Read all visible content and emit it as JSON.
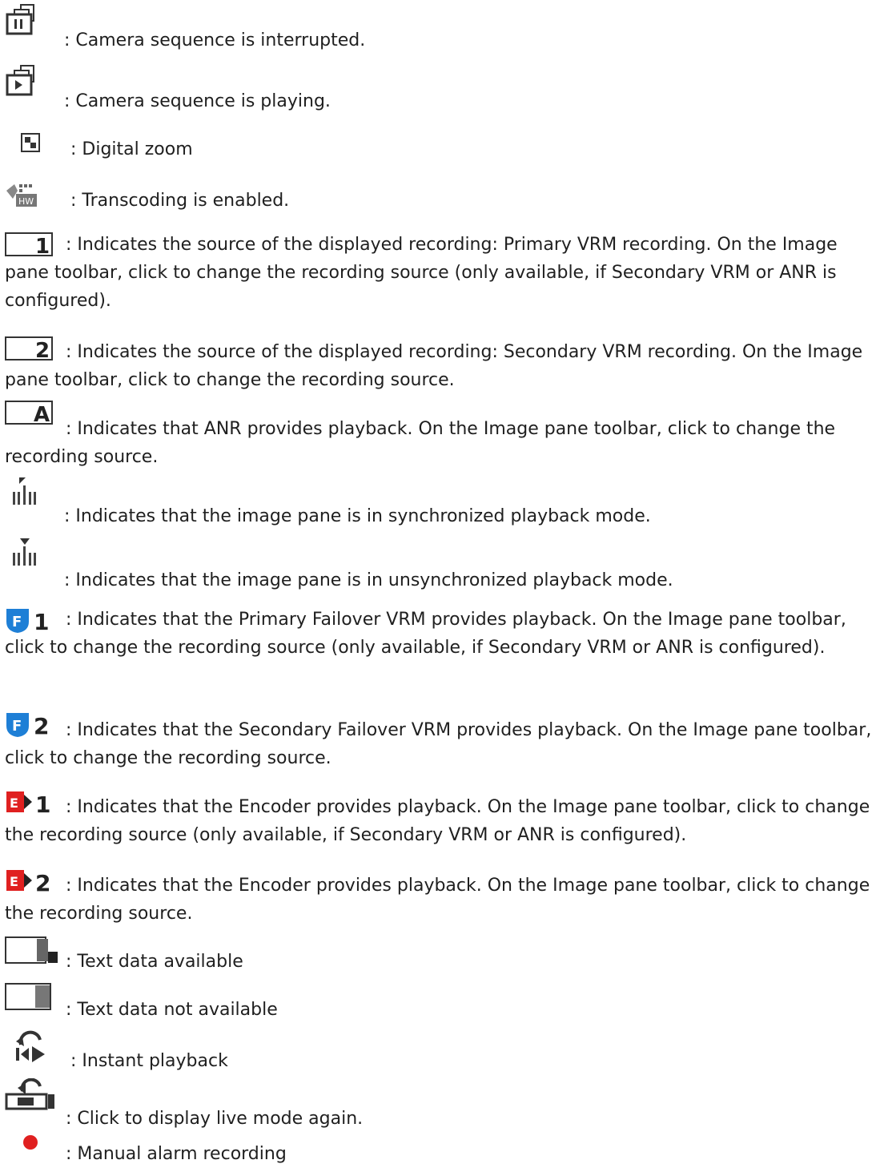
{
  "items": [
    {
      "icon": "camera-sequence-paused-icon",
      "text": ": Camera sequence is interrupted."
    },
    {
      "icon": "camera-sequence-playing-icon",
      "text": ": Camera sequence is playing."
    },
    {
      "icon": "digital-zoom-icon",
      "text": ": Digital zoom"
    },
    {
      "icon": "transcoding-icon",
      "text": ": Transcoding is enabled."
    },
    {
      "icon": "source-1-icon",
      "text": ": Indicates the source of the displayed recording: Primary VRM recording. On the Image pane toolbar, click to change the recording source (only available, if Secondary VRM or ANR is configured)."
    },
    {
      "icon": "source-2-icon",
      "text": ": Indicates the source of the displayed recording: Secondary VRM recording. On the Image pane toolbar, click to change the recording source."
    },
    {
      "icon": "source-anr-icon",
      "text": ": Indicates that ANR provides playback. On the Image pane toolbar, click to change the recording source."
    },
    {
      "icon": "sync-playback-icon",
      "text": ": Indicates that the image pane is in synchronized playback mode."
    },
    {
      "icon": "unsync-playback-icon",
      "text": ": Indicates that the image pane is in unsynchronized playback mode."
    },
    {
      "icon": "failover-1-icon",
      "text": ": Indicates that the Primary Failover VRM provides playback. On the Image pane toolbar, click to change the recording source (only available, if Secondary VRM or ANR is configured)."
    },
    {
      "icon": "failover-2-icon",
      "text": ": Indicates that the Secondary Failover VRM provides playback. On the Image pane toolbar, click to change the recording source."
    },
    {
      "icon": "encoder-1-icon",
      "text": ": Indicates that the Encoder provides playback. On the Image pane toolbar, click to change the recording source (only available, if Secondary VRM or ANR is configured)."
    },
    {
      "icon": "encoder-2-icon",
      "text": ": Indicates that the Encoder provides playback. On the Image pane toolbar, click to change the recording source."
    },
    {
      "icon": "text-data-available-icon",
      "text": ": Text data available"
    },
    {
      "icon": "text-data-unavailable-icon",
      "text": ": Text data not available"
    },
    {
      "icon": "instant-playback-icon",
      "text": ": Instant playback"
    },
    {
      "icon": "live-mode-icon",
      "text": ": Click to display live mode again."
    },
    {
      "icon": "manual-alarm-recording-icon",
      "text": ": Manual alarm recording"
    }
  ],
  "colors": {
    "text": "#1f1f1f",
    "icon_blue": "#1e7fd6",
    "icon_red": "#e02020",
    "icon_gray": "#606060"
  }
}
